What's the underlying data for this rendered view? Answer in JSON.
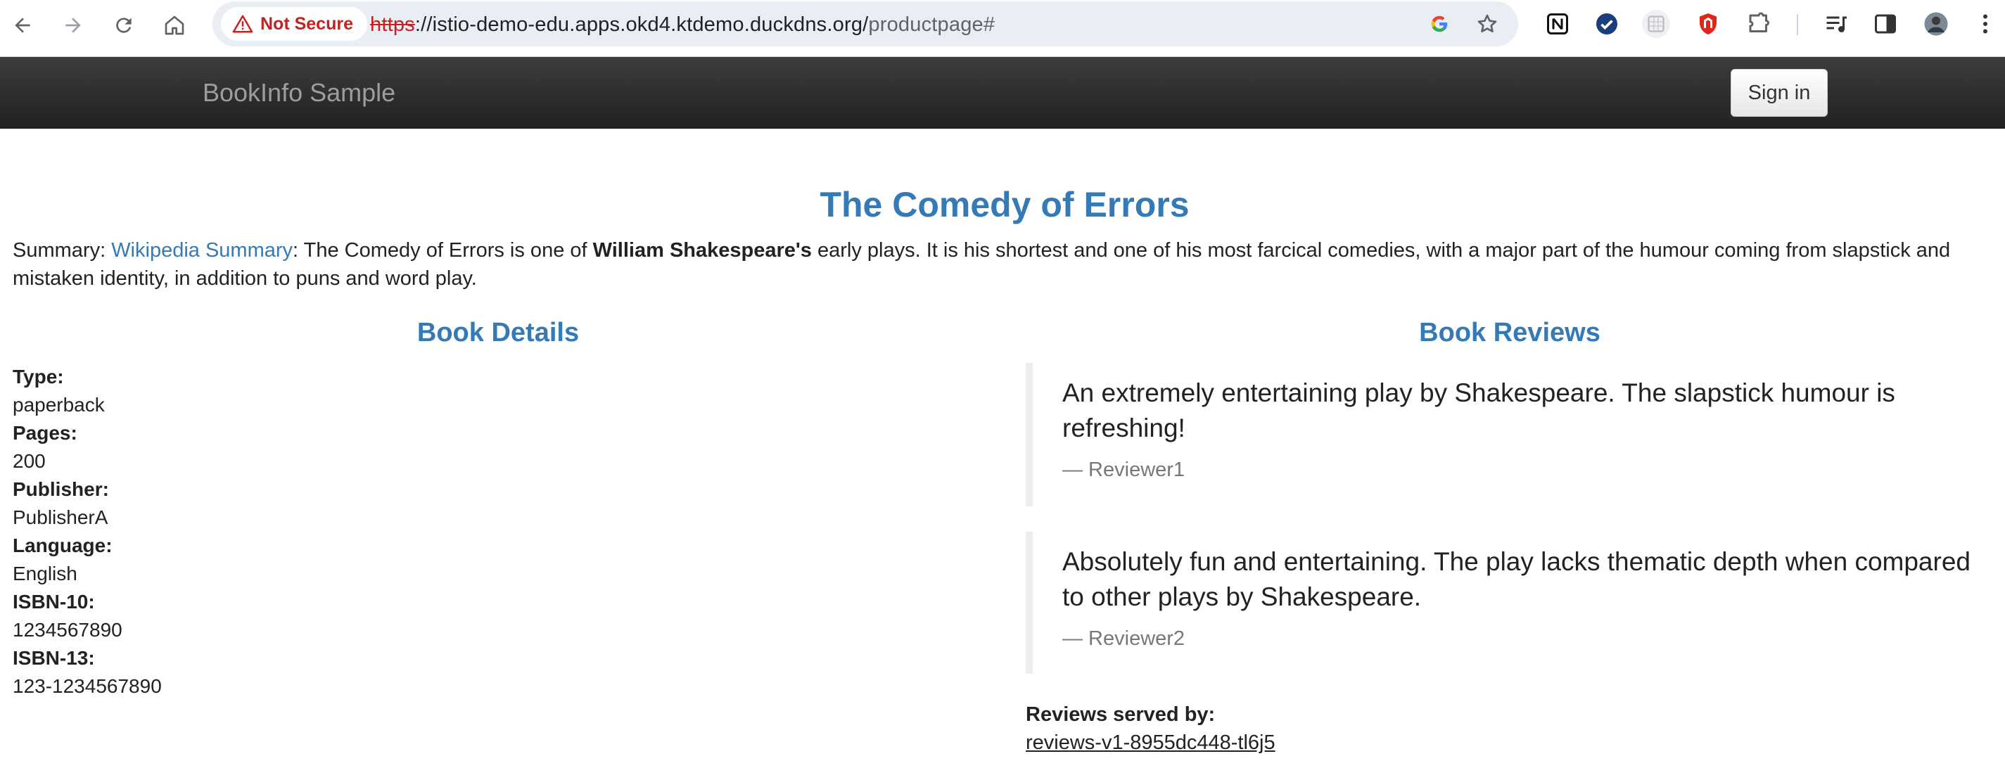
{
  "browser": {
    "security_label": "Not Secure",
    "url_scheme": "https",
    "url_host": "://istio-demo-edu.apps.okd4.ktdemo.duckdns.org/",
    "url_path": "productpage#"
  },
  "navbar": {
    "brand": "BookInfo Sample",
    "signin_label": "Sign in"
  },
  "book": {
    "title": "The Comedy of Errors",
    "summary_prefix": "Summary: ",
    "summary_link": "Wikipedia Summary",
    "summary_text_1": ": The Comedy of Errors is one of ",
    "summary_bold": "William Shakespeare's",
    "summary_text_2": " early plays. It is his shortest and one of his most farcical comedies, with a major part of the humour coming from slapstick and mistaken identity, in addition to puns and word play."
  },
  "details": {
    "heading": "Book Details",
    "type_label": "Type:",
    "type_value": "paperback",
    "pages_label": "Pages:",
    "pages_value": "200",
    "publisher_label": "Publisher:",
    "publisher_value": "PublisherA",
    "language_label": "Language:",
    "language_value": "English",
    "isbn10_label": "ISBN-10:",
    "isbn10_value": "1234567890",
    "isbn13_label": "ISBN-13:",
    "isbn13_value": "123-1234567890"
  },
  "reviews": {
    "heading": "Book Reviews",
    "items": [
      {
        "text": "An extremely entertaining play by Shakespeare. The slapstick humour is refreshing!",
        "reviewer": "— Reviewer1"
      },
      {
        "text": "Absolutely fun and entertaining. The play lacks thematic depth when compared to other plays by Shakespeare.",
        "reviewer": "— Reviewer2"
      }
    ],
    "served_by_label": "Reviews served by:",
    "served_by_value": "reviews-v1-8955dc448-tl6j5"
  },
  "colors": {
    "accent": "#337ab7",
    "navbar": "#222222",
    "warning": "#c5221f"
  },
  "icons": [
    "back-icon",
    "forward-icon",
    "reload-icon",
    "home-icon",
    "warning-icon",
    "google-icon",
    "star-icon",
    "notion-icon",
    "check-icon",
    "grid-icon",
    "shield-icon",
    "puzzle-icon",
    "playlist-icon",
    "sidepanel-icon",
    "avatar",
    "more-icon"
  ]
}
